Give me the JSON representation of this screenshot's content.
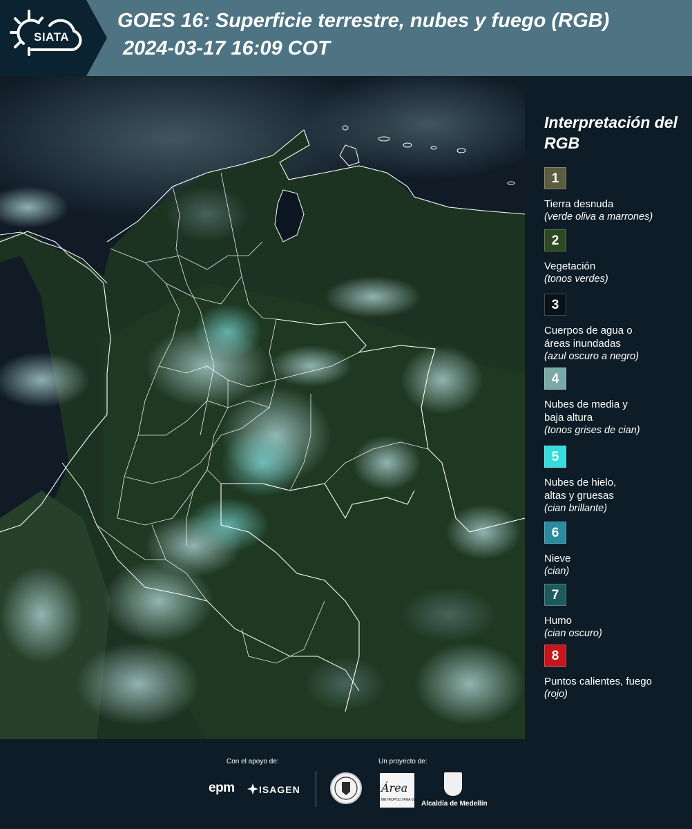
{
  "header": {
    "logo_text": "SIATA",
    "title": "GOES 16: Superficie terrestre, nubes y fuego (RGB)",
    "subtitle": "2024-03-17 16:09 COT"
  },
  "legend": {
    "title": "Interpretación del RGB",
    "items": [
      {
        "num": "1",
        "label": "Tierra desnuda",
        "sub": "(verde oliva a marrones)",
        "color": "#5c5d3e"
      },
      {
        "num": "2",
        "label": "Vegetación",
        "sub": "(tonos verdes)",
        "color": "#2b4a22"
      },
      {
        "num": "3",
        "label": "Cuerpos de agua o áreas inundadas",
        "sub": "(azul oscuro a negro)",
        "color": "#07121a"
      },
      {
        "num": "4",
        "label": "Nubes de media y baja altura",
        "sub": "(tonos grises de cian)",
        "color": "#7aaaa8"
      },
      {
        "num": "5",
        "label": "Nubes de hielo, altas y gruesas",
        "sub": "(cian brillante)",
        "color": "#34dcdc"
      },
      {
        "num": "6",
        "label": "Nieve",
        "sub": "(cian)",
        "color": "#2a8aa0"
      },
      {
        "num": "7",
        "label": "Humo",
        "sub": "(cian oscuro)",
        "color": "#1e5a5c"
      },
      {
        "num": "8",
        "label": "Puntos calientes, fuego",
        "sub": "(rojo)",
        "color": "#c8151b"
      }
    ]
  },
  "footer": {
    "support_label": "Con el apoyo de:",
    "project_label": "Un proyecto de:",
    "epm": "epm",
    "isagen": "ISAGEN",
    "area_logo": "Área",
    "area_small": "METROPOLITANA Valle de Aburrá",
    "medellin": "Alcaldía de Medellín"
  }
}
